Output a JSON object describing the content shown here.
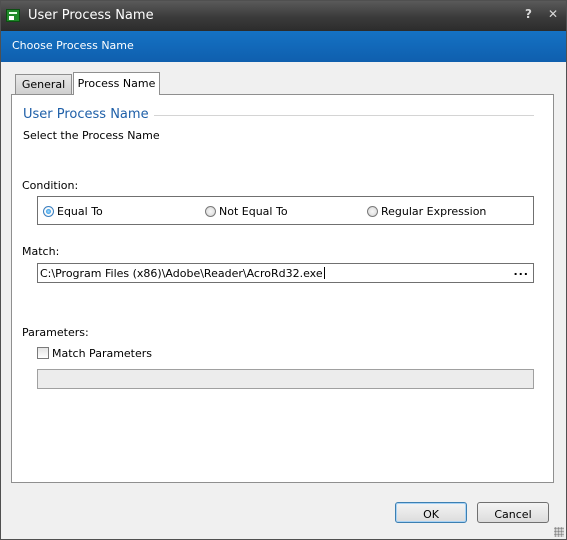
{
  "window": {
    "title": "User Process Name",
    "help_glyph": "?",
    "close_glyph": "✕",
    "header_text": "Choose Process Name"
  },
  "tabs": [
    {
      "label": "General",
      "active": false
    },
    {
      "label": "Process Name",
      "active": true
    }
  ],
  "panel": {
    "section_title": "User Process Name",
    "section_description": "Select the Process Name",
    "condition": {
      "label": "Condition:",
      "options": [
        "Equal To",
        "Not Equal To",
        "Regular Expression"
      ],
      "selected": "Equal To"
    },
    "match": {
      "label": "Match:",
      "value": "C:\\Program Files (x86)\\Adobe\\Reader\\AcroRd32.exe",
      "browse_label": "..."
    },
    "parameters": {
      "label": "Parameters:",
      "checkbox_label": "Match Parameters",
      "checked": false,
      "value": ""
    }
  },
  "buttons": {
    "ok": "OK",
    "cancel": "Cancel"
  },
  "colors": {
    "title_bar": "#3a3a3a",
    "header_band": "#1572c4",
    "section_title": "#1e5fa8"
  }
}
